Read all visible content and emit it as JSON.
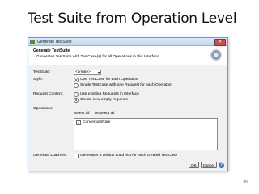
{
  "slide": {
    "title": "Test Suite from Operation Level",
    "page_number": "85"
  },
  "dialog": {
    "window_title": "Generate TestSuite",
    "heading": "Generate TestSuite",
    "description": "Generates TestSuite with TestCase(s) for all Operations in this Interface",
    "test_suite_label": "TestSuite:",
    "test_suite_value": "<create>",
    "style_label": "Style:",
    "style_options": [
      "One TestCase for each Operation",
      "Single TestCase with one Request for each Operation"
    ],
    "style_selected": 0,
    "request_content_label": "Request Content:",
    "request_options": [
      "Use existing Requests in Interface",
      "Create new empty requests"
    ],
    "request_selected": 1,
    "operations_label": "Operations:",
    "select_all": "Select all",
    "unselect_all": "Unselect all",
    "operations": [
      {
        "name": "ConversionRate",
        "checked": true
      }
    ],
    "load_test_label": "Generate LoadTest:",
    "load_test_option": "Generates a default LoadTest for each created TestCase",
    "ok_label": "OK",
    "cancel_label": "Cancel",
    "help_symbol": "?"
  }
}
